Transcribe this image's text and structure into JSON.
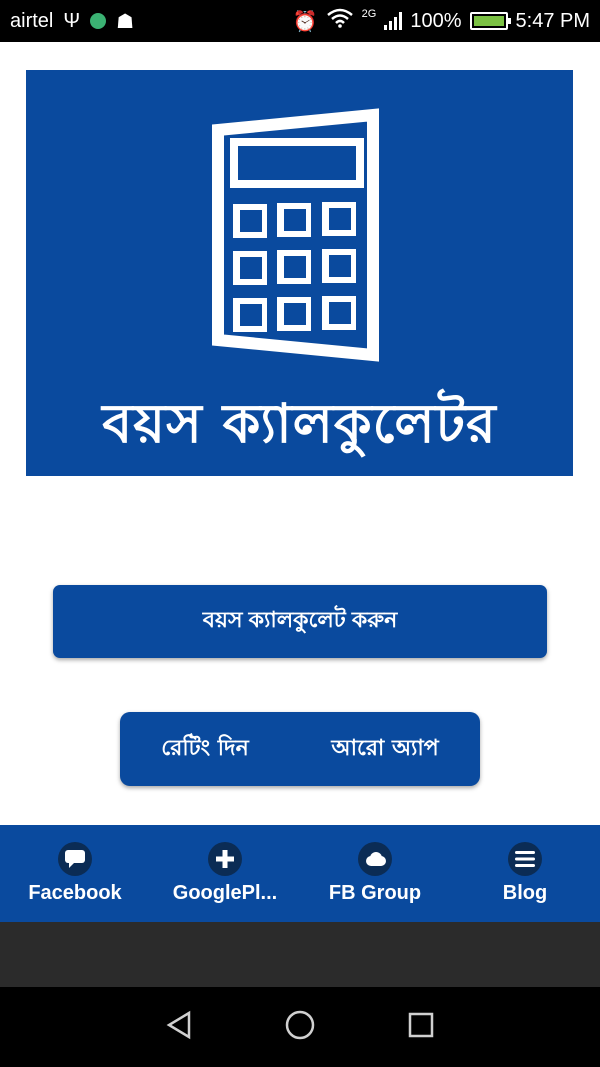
{
  "status_bar": {
    "carrier": "airtel",
    "network": "2G",
    "battery": "100%",
    "time": "5:47 PM"
  },
  "banner": {
    "title": "বয়স ক্যালকুলেটর",
    "icon": "calculator-icon"
  },
  "actions": {
    "calculate_label": "বয়স ক্যালকুলেট করুন",
    "rate_label": "রেটিং দিন",
    "more_apps_label": "আরো অ্যাপ"
  },
  "bottom_nav": {
    "items": [
      {
        "label": "Facebook",
        "icon": "chat-bubble-icon"
      },
      {
        "label": "GooglePl...",
        "icon": "plus-icon"
      },
      {
        "label": "FB Group",
        "icon": "cloud-icon"
      },
      {
        "label": "Blog",
        "icon": "menu-icon"
      }
    ]
  },
  "colors": {
    "primary": "#0a4a9e",
    "nav_icon_bg": "#0b2c55",
    "status_bar": "#000000"
  }
}
